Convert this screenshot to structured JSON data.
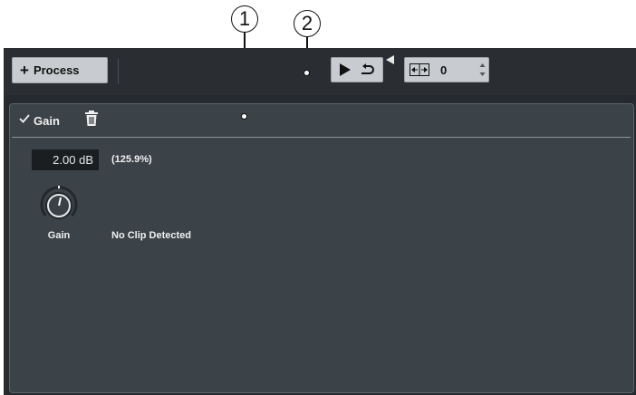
{
  "annotations": [
    "1",
    "2"
  ],
  "toolbar": {
    "process_label": "Process",
    "stretch_value": "0"
  },
  "effect": {
    "name": "Gain",
    "gain_value": "2.00 dB",
    "percent": "(125.9%)",
    "knob_label": "Gain",
    "clip_status": "No Clip Detected"
  },
  "icons": {
    "process_add": "plus-icon",
    "play": "play-icon",
    "loop": "loop-icon",
    "play_menu": "menu-arrow-icon",
    "stretch": "stretch-icon",
    "stepper": "stepper-icon",
    "enabled": "check-icon",
    "delete": "trash-icon",
    "knob": "knob-icon"
  },
  "colors": {
    "background": "#262a2e",
    "panel": "#3b4248",
    "button": "#c8cbcf",
    "text": "#f0f0f0"
  }
}
